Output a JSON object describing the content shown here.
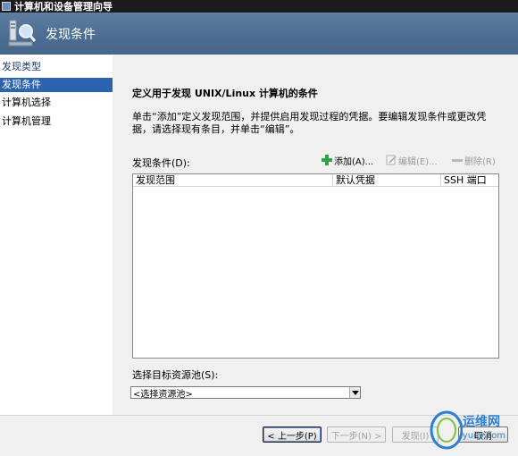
{
  "window": {
    "title": "计算机和设备管理向导"
  },
  "banner": {
    "title": "发现条件"
  },
  "nav": {
    "items": [
      {
        "label": "发现类型"
      },
      {
        "label": "发现条件"
      },
      {
        "label": "计算机选择"
      },
      {
        "label": "计算机管理"
      }
    ],
    "active_index": 1
  },
  "main": {
    "heading": "定义用于发现 UNIX/Linux 计算机的条件",
    "description": "单击“添加”定义发现范围，并提供启用发现过程的凭据。要编辑发现条件或更改凭据，请选择现有条目，并单击“编辑”。",
    "list_label": "发现条件(D):",
    "toolbar": {
      "add_label": "添加(A)...",
      "edit_label": "编辑(E)...",
      "delete_label": "删除(R)"
    },
    "columns": [
      "发现范围",
      "默认凭据",
      "SSH 端口"
    ],
    "rows": [],
    "pool_label": "选择目标资源池(S):",
    "pool_select": {
      "value": "<选择资源池>"
    }
  },
  "footer": {
    "back_label": "< 上一步(P)",
    "next_label": "下一步(N) >",
    "discover_label": "发现(I)",
    "cancel_label": "取消"
  },
  "watermark": {
    "line1": "运维网",
    "line2": "iyunv.com"
  },
  "colors": {
    "accent": "#2c63ae",
    "banner": "#4e6f93",
    "add_icon": "#2ea24a"
  }
}
